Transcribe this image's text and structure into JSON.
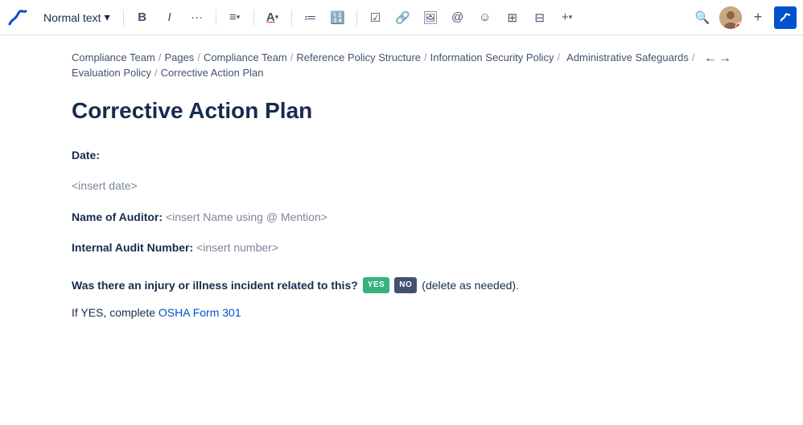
{
  "toolbar": {
    "text_style_label": "Normal text",
    "chevron": "▾",
    "bold_icon": "B",
    "italic_icon": "I",
    "more_icon": "•••",
    "align_icon": "≡",
    "color_icon": "A",
    "bullet_icon": "≡",
    "numbered_icon": "≡",
    "task_icon": "☑",
    "link_icon": "🔗",
    "image_icon": "🖼",
    "mention_icon": "@",
    "emoji_icon": "☺",
    "table_icon": "⊞",
    "column_icon": "⊟",
    "plus_icon": "+",
    "search_icon": "🔍",
    "add_btn": "+",
    "cursor_icon": "↖"
  },
  "breadcrumb": {
    "items": [
      {
        "label": "Compliance Team",
        "link": true
      },
      {
        "label": "Pages",
        "link": true
      },
      {
        "label": "Compliance Team",
        "link": true
      },
      {
        "label": "Reference Policy Structure",
        "link": true
      },
      {
        "label": "Information Security Policy",
        "link": true
      },
      {
        "label": "Administrative Safeguards",
        "link": true
      },
      {
        "label": "Evaluation Policy",
        "link": true
      },
      {
        "label": "Corrective Action Plan",
        "link": false
      }
    ],
    "expand_left": "←",
    "expand_right": "→"
  },
  "page": {
    "title": "Corrective Action Plan",
    "date_label": "Date:",
    "date_placeholder": "<insert date>",
    "auditor_label": "Name of Auditor:",
    "auditor_placeholder": "<insert Name using @ Mention>",
    "audit_number_label": "Internal Audit Number:",
    "audit_number_placeholder": "<insert number>",
    "question_text": "Was there an injury or illness incident related to this?",
    "badge_yes": "YES",
    "badge_no": "NO",
    "delete_note": "(delete as needed).",
    "osha_prefix": "If YES, complete ",
    "osha_link_text": "OSHA Form 301",
    "osha_link_url": "#"
  }
}
